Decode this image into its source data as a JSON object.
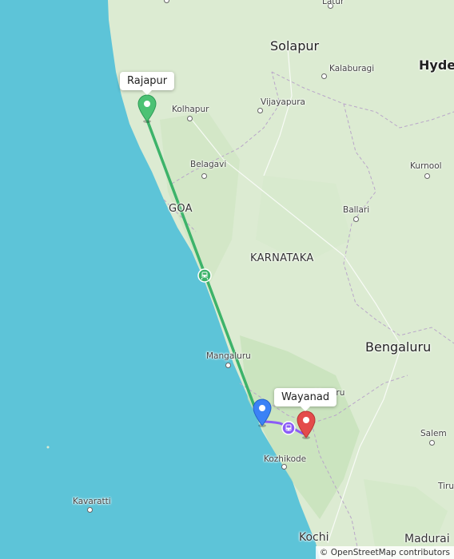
{
  "map": {
    "route": {
      "origin": "Rajapur",
      "destination": "Wayanad",
      "colors": {
        "train": "#3db36a",
        "walk": "#8b5cf6",
        "origin_pin": "#4cc274",
        "waypoint_pin": "#3b82f6",
        "destination_pin": "#e44b4b"
      }
    },
    "labels": {
      "latur": "Latur",
      "solapur": "Solapur",
      "hyderabad": "Hyder",
      "kalaburagi": "Kalaburagi",
      "kolhapur": "Kolhapur",
      "vijayapura": "Vijayapura",
      "belagavi": "Belagavi",
      "kurnool": "Kurnool",
      "goa": "GOA",
      "ballari": "Ballari",
      "karnataka": "KARNATAKA",
      "bengaluru": "Bengaluru",
      "mangaluru": "Mangaluru",
      "mysuru": "Mysuru",
      "salem": "Salem",
      "kozhikode": "Kozhikode",
      "kavaratti": "Kavaratti",
      "tiruchirappalli": "Tirud",
      "kochi": "Kochi",
      "madurai": "Madurai"
    },
    "attribution": "© OpenStreetMap contributors"
  }
}
